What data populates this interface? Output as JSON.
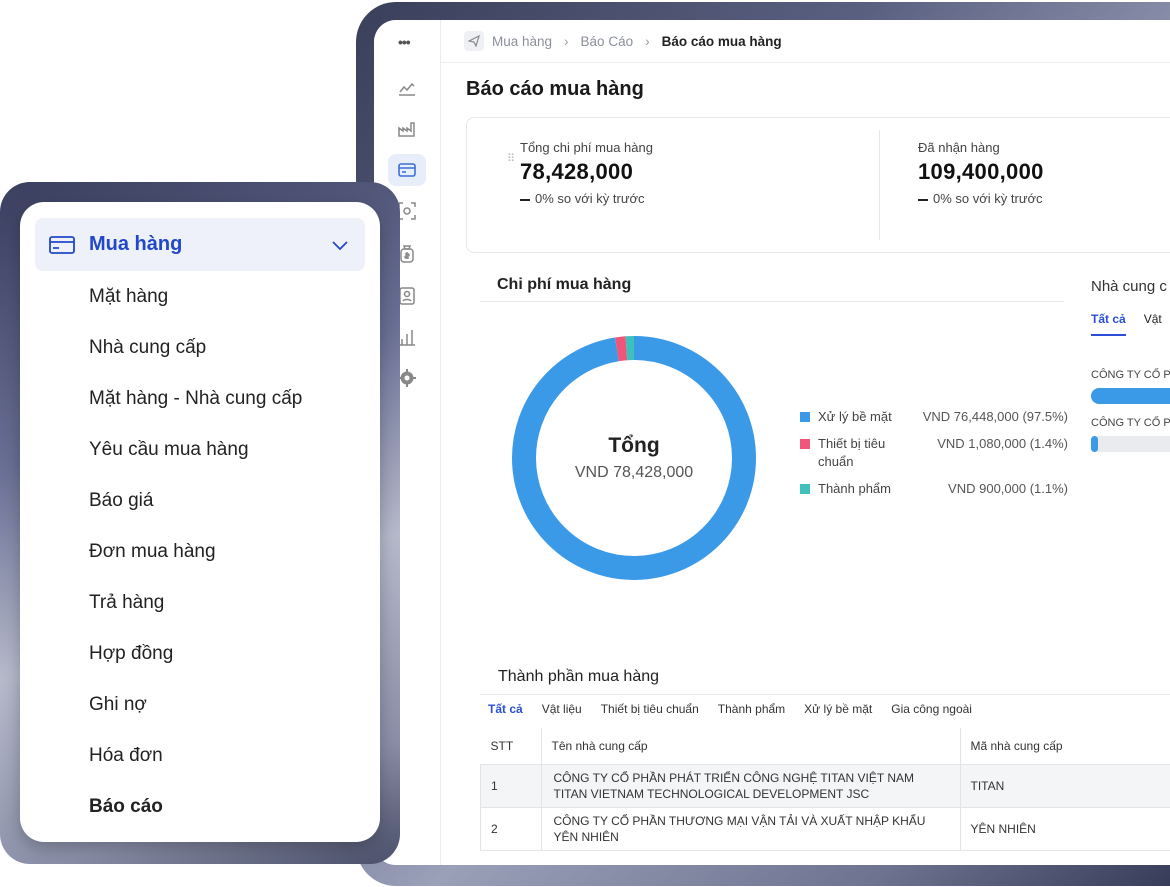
{
  "breadcrumb": {
    "items": [
      "Mua hàng",
      "Báo Cáo",
      "Báo cáo mua hàng"
    ]
  },
  "page": {
    "title": "Báo cáo mua hàng"
  },
  "stats": [
    {
      "label": "Tổng chi phí mua hàng",
      "value": "78,428,000",
      "change": "0% so với kỳ trước"
    },
    {
      "label": "Đã nhận hàng",
      "value": "109,400,000",
      "change": "0% so với kỳ trước"
    }
  ],
  "cost_chart": {
    "title": "Chi phí mua hàng",
    "center_title": "Tổng",
    "center_value": "VND 78,428,000"
  },
  "chart_data": {
    "type": "pie",
    "categories": [
      "Xử lý bề mặt",
      "Thiết bị tiêu chuẩn",
      "Thành phẩm"
    ],
    "values": [
      76448000,
      1080000,
      900000
    ],
    "value_labels": [
      "VND 76,448,000 (97.5%)",
      "VND 1,080,000 (1.4%)",
      "VND 900,000 (1.1%)"
    ],
    "colors": [
      "#3b9ae8",
      "#f0567a",
      "#3ec0bd"
    ],
    "title": "Chi phí mua hàng"
  },
  "suppliers": {
    "title": "Nhà cung c",
    "tabs": [
      "Tất cả",
      "Vật"
    ],
    "rows": [
      {
        "name": "CÔNG TY CỔ P",
        "share": 1.0
      },
      {
        "name": "CÔNG TY CỔ P",
        "share": 0.05
      }
    ]
  },
  "components": {
    "title": "Thành phần mua hàng",
    "tabs": [
      "Tất cả",
      "Vật liệu",
      "Thiết bị tiêu chuẩn",
      "Thành phẩm",
      "Xử lý bề mặt",
      "Gia công ngoài"
    ],
    "columns": [
      "STT",
      "Tên nhà cung cấp",
      "Mã nhà cung cấp"
    ],
    "rows": [
      [
        "1",
        "CÔNG TY CỔ PHẦN PHÁT TRIỂN CÔNG NGHỆ TITAN VIỆT NAM TITAN VIETNAM TECHNOLOGICAL DEVELOPMENT JSC",
        "TITAN"
      ],
      [
        "2",
        "CÔNG TY CỔ PHẦN THƯƠNG MẠI VẬN TẢI VÀ XUẤT NHẬP KHẨU YÊN NHIÊN",
        "YÊN NHIÊN"
      ]
    ]
  },
  "menu": {
    "header": "Mua hàng",
    "items": [
      "Mặt hàng",
      "Nhà cung cấp",
      "Mặt hàng - Nhà cung cấp",
      "Yêu cầu mua hàng",
      "Báo giá",
      "Đơn mua hàng",
      "Trả hàng",
      "Hợp đồng",
      "Ghi nợ",
      "Hóa đơn",
      "Báo cáo"
    ]
  },
  "rail_icons": [
    "apps-icon",
    "line-chart-icon",
    "factory-icon",
    "card-icon",
    "scan-icon",
    "money-bag-icon",
    "contacts-icon",
    "bar-chart-icon",
    "gear-icon"
  ]
}
